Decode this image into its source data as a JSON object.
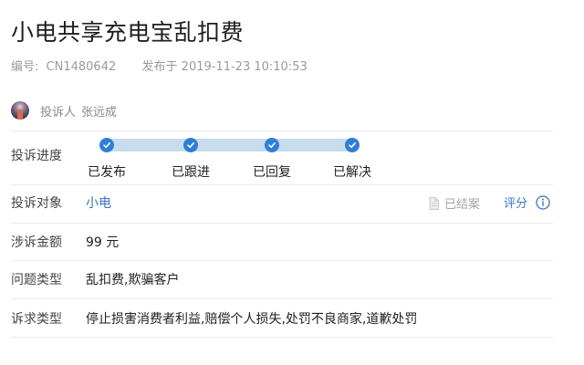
{
  "page": {
    "title": "小电共享充电宝乱扣费",
    "id_label": "编号:",
    "id_value": "CN1480642",
    "published_label": "发布于",
    "published_value": "2019-11-23 10:10:53"
  },
  "complainant": {
    "label": "投诉人",
    "name": "张远成",
    "avatar_icon": "avatar-image"
  },
  "progress": {
    "label": "投诉进度",
    "steps": [
      {
        "label": "已发布",
        "done": true
      },
      {
        "label": "已跟进",
        "done": true
      },
      {
        "label": "已回复",
        "done": true
      },
      {
        "label": "已解决",
        "done": true
      }
    ],
    "track_color": "#c7dcec",
    "dot_color": "#2e7fd6"
  },
  "target": {
    "label": "投诉对象",
    "value": "小电",
    "status_icon": "document-icon",
    "status_text": "已结案",
    "rate_label": "评分",
    "info_icon": "info-icon"
  },
  "amount": {
    "label": "涉诉金额",
    "value": "99 元"
  },
  "issue_type": {
    "label": "问题类型",
    "value": "乱扣费,欺骗客户"
  },
  "demand_type": {
    "label": "诉求类型",
    "value": "停止损害消费者利益,赔偿个人损失,处罚不良商家,道歉处罚"
  },
  "colors": {
    "link": "#3a74c7",
    "muted": "#9a9a9a"
  }
}
